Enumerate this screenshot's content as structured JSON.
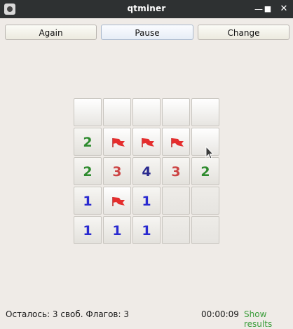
{
  "window": {
    "title": "qtminer"
  },
  "toolbar": {
    "again": "Again",
    "pause": "Pause",
    "change": "Change"
  },
  "board": {
    "rows": 5,
    "cols": 5,
    "cells": [
      [
        {
          "s": "closed"
        },
        {
          "s": "closed"
        },
        {
          "s": "closed"
        },
        {
          "s": "closed"
        },
        {
          "s": "closed"
        }
      ],
      [
        {
          "s": "open",
          "v": "2"
        },
        {
          "s": "flag"
        },
        {
          "s": "flag"
        },
        {
          "s": "flag"
        },
        {
          "s": "closed"
        }
      ],
      [
        {
          "s": "open",
          "v": "2"
        },
        {
          "s": "open",
          "v": "3"
        },
        {
          "s": "open",
          "v": "4"
        },
        {
          "s": "open",
          "v": "3"
        },
        {
          "s": "open",
          "v": "2"
        }
      ],
      [
        {
          "s": "open",
          "v": "1"
        },
        {
          "s": "flag"
        },
        {
          "s": "open",
          "v": "1"
        },
        {
          "s": "empty"
        },
        {
          "s": "empty"
        }
      ],
      [
        {
          "s": "open",
          "v": "1"
        },
        {
          "s": "open",
          "v": "1"
        },
        {
          "s": "open",
          "v": "1"
        },
        {
          "s": "empty"
        },
        {
          "s": "empty"
        }
      ]
    ],
    "number_colors": {
      "1": "#2a2ad0",
      "2": "#2e8b2e",
      "3": "#cc4444",
      "4": "#2b2b8f"
    },
    "flag_color": "#e52d2d"
  },
  "status": {
    "remaining": "Осталось: 3 своб.  Флагов: 3",
    "time": "00:00:09",
    "show_results": "Show results"
  }
}
